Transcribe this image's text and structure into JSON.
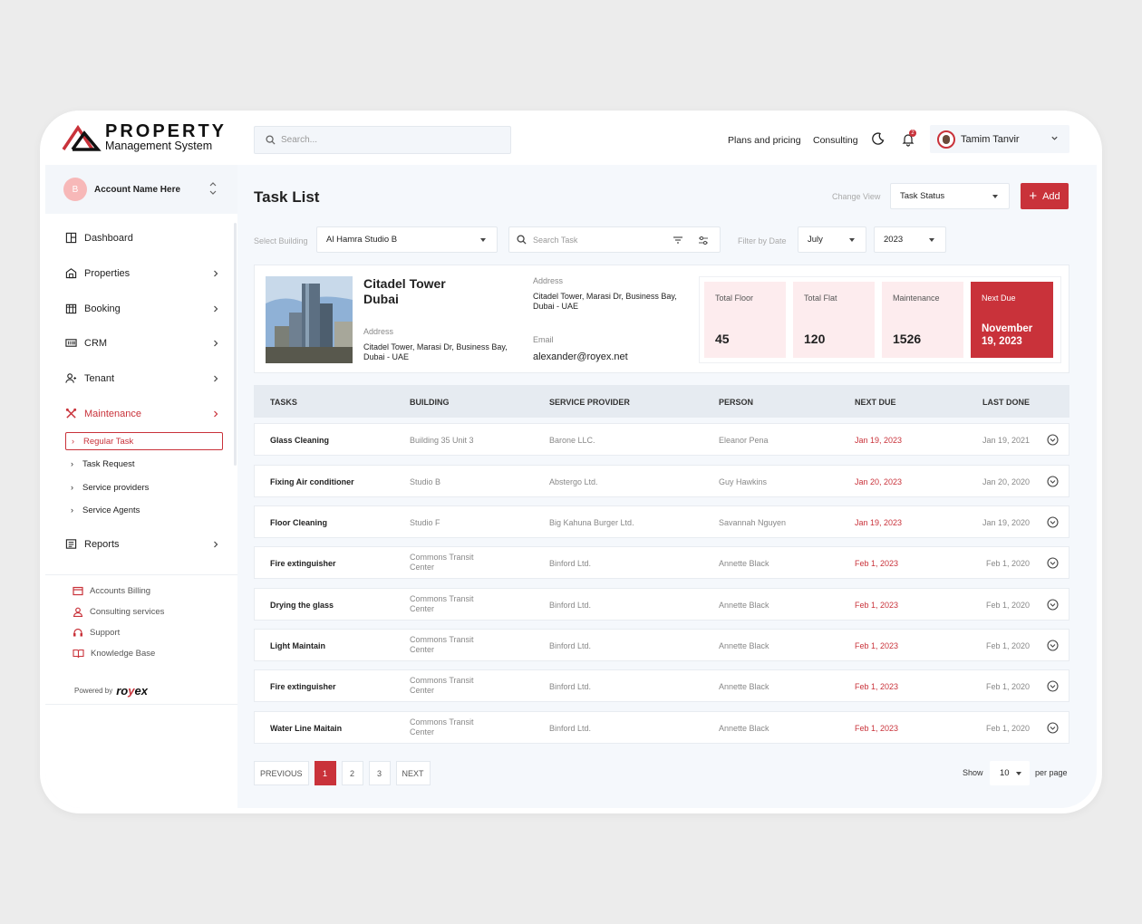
{
  "brand": {
    "title": "PROPERTY",
    "subtitle": "Management System",
    "accent": "#c9323a"
  },
  "search": {
    "placeholder": "Search..."
  },
  "topnav": {
    "plans": "Plans and pricing",
    "consulting": "Consulting",
    "notifications_count": "2",
    "user_name": "Tamim Tanvir"
  },
  "account": {
    "initial": "B",
    "name": "Account Name Here"
  },
  "sidebar": {
    "items": [
      {
        "label": "Dashboard",
        "icon": "dashboard-icon"
      },
      {
        "label": "Properties",
        "icon": "properties-icon"
      },
      {
        "label": "Booking",
        "icon": "booking-icon"
      },
      {
        "label": "CRM",
        "icon": "crm-icon"
      },
      {
        "label": "Tenant",
        "icon": "tenant-icon"
      },
      {
        "label": "Maintenance",
        "icon": "maintenance-icon"
      },
      {
        "label": "Reports",
        "icon": "reports-icon"
      }
    ],
    "subitems": [
      "Regular Task",
      "Task Request",
      "Service providers",
      "Service Agents"
    ],
    "bottom_links": [
      "Accounts Billing",
      "Consulting services",
      "Support",
      "Knowledge Base"
    ],
    "powered_by": "Powered by",
    "powered_brand_a": "ro",
    "powered_brand_b": "y",
    "powered_brand_c": "ex"
  },
  "page": {
    "title": "Task List",
    "change_view_label": "Change View",
    "change_view_value": "Task Status",
    "add_label": "Add",
    "select_building_label": "Select Building",
    "select_building_value": "Al Hamra Studio B",
    "search_task_placeholder": "Search Task",
    "filter_date_label": "Filter by  Date",
    "month": "July",
    "year": "2023"
  },
  "building": {
    "name": "Citadel Tower Dubai",
    "address_label": "Address",
    "address": "Citadel Tower, Marasi Dr, Business Bay, Dubai - UAE",
    "address_label_2": "Address",
    "address_2": "Citadel Tower, Marasi Dr, Business Bay, Dubai - UAE",
    "email_label": "Email",
    "email": "alexander@royex.net",
    "stats": [
      {
        "label": "Total Floor",
        "value": "45"
      },
      {
        "label": "Total Flat",
        "value": "120"
      },
      {
        "label": "Maintenance",
        "value": "1526"
      },
      {
        "label": "Next Due",
        "value": "November 19, 2023"
      }
    ]
  },
  "table": {
    "headers": [
      "TASKS",
      "BUILDING",
      "SERVICE PROVIDER",
      "PERSON",
      "NEXT DUE",
      "LAST DONE"
    ],
    "rows": [
      {
        "task": "Glass Cleaning",
        "building": "Building 35 Unit 3",
        "provider": "Barone LLC.",
        "person": "Eleanor Pena",
        "next_due": "Jan 19, 2023",
        "last_done": "Jan 19, 2021"
      },
      {
        "task": "Fixing Air conditioner",
        "building": "Studio B",
        "provider": "Abstergo Ltd.",
        "person": "Guy Hawkins",
        "next_due": "Jan 20, 2023",
        "last_done": "Jan 20, 2020"
      },
      {
        "task": "Floor Cleaning",
        "building": "Studio F",
        "provider": "Big Kahuna Burger Ltd.",
        "person": "Savannah Nguyen",
        "next_due": "Jan 19, 2023",
        "last_done": "Jan 19, 2020"
      },
      {
        "task": "Fire extinguisher",
        "building": "Commons Transit Center",
        "provider": "Binford Ltd.",
        "person": "Annette Black",
        "next_due": "Feb 1, 2023",
        "last_done": "Feb 1, 2020"
      },
      {
        "task": "Drying the glass",
        "building": "Commons Transit Center",
        "provider": "Binford Ltd.",
        "person": "Annette Black",
        "next_due": "Feb 1, 2023",
        "last_done": "Feb 1, 2020"
      },
      {
        "task": "Light Maintain",
        "building": "Commons Transit Center",
        "provider": "Binford Ltd.",
        "person": "Annette Black",
        "next_due": "Feb 1, 2023",
        "last_done": "Feb 1, 2020"
      },
      {
        "task": "Fire extinguisher",
        "building": "Commons Transit Center",
        "provider": "Binford Ltd.",
        "person": "Annette Black",
        "next_due": "Feb 1, 2023",
        "last_done": "Feb 1, 2020"
      },
      {
        "task": "Water Line Maitain",
        "building": "Commons Transit Center",
        "provider": "Binford Ltd.",
        "person": "Annette Black",
        "next_due": "Feb 1, 2023",
        "last_done": "Feb 1, 2020"
      }
    ]
  },
  "pagination": {
    "previous": "PREVIOUS",
    "pages": [
      "1",
      "2",
      "3"
    ],
    "current": "1",
    "next": "NEXT",
    "show_label": "Show",
    "per_page_value": "10",
    "per_page_label": "per page"
  }
}
